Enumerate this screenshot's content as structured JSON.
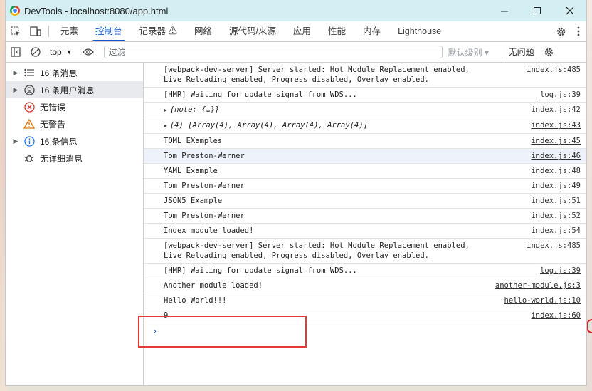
{
  "window": {
    "title": "DevTools - localhost:8080/app.html"
  },
  "colors": {
    "titlebar_bg": "#d4eef3",
    "accent": "#0b57d0",
    "error_red": "#d93025",
    "warning_yellow": "#e37400",
    "info_blue": "#1a73e8",
    "annotation_box": "#e53935"
  },
  "tabs": [
    {
      "label": "元素"
    },
    {
      "label": "控制台",
      "active": true
    },
    {
      "label": "记录器 ⚠"
    },
    {
      "label": "网络"
    },
    {
      "label": "源代码/来源"
    },
    {
      "label": "应用"
    },
    {
      "label": "性能"
    },
    {
      "label": "内存"
    },
    {
      "label": "Lighthouse"
    }
  ],
  "toolbar": {
    "context": "top",
    "filter_placeholder": "过滤",
    "levels": "默认级别 ▾",
    "issues": "无问题"
  },
  "sidebar": [
    {
      "label": "16 条消息",
      "icon": "list-icon",
      "expandable": true
    },
    {
      "label": "16 条用户消息",
      "icon": "user-icon",
      "expandable": true,
      "selected": true
    },
    {
      "label": "无错误",
      "icon": "error-icon",
      "expandable": false
    },
    {
      "label": "无警告",
      "icon": "warning-icon",
      "expandable": false
    },
    {
      "label": "16 条信息",
      "icon": "info-icon",
      "expandable": true
    },
    {
      "label": "无详细消息",
      "icon": "bug-icon",
      "expandable": false
    }
  ],
  "console": [
    {
      "text": "[webpack-dev-server] Server started: Hot Module Replacement enabled,\nLive Reloading enabled, Progress disabled, Overlay enabled.",
      "source": "index.js:485"
    },
    {
      "text": "[HMR] Waiting for update signal from WDS...",
      "source": "log.js:39"
    },
    {
      "text": "{note: {…}}",
      "source": "index.js:42",
      "object": true
    },
    {
      "text": "(4) [Array(4), Array(4), Array(4), Array(4)]",
      "source": "index.js:43",
      "object": true
    },
    {
      "text": "TOML EXamples",
      "source": "index.js:45"
    },
    {
      "text": "Tom Preston-Werner",
      "source": "index.js:46",
      "highlight": true
    },
    {
      "text": "YAML Example",
      "source": "index.js:48"
    },
    {
      "text": "Tom Preston-Werner",
      "source": "index.js:49"
    },
    {
      "text": "JSON5 Example",
      "source": "index.js:51"
    },
    {
      "text": "Tom Preston-Werner",
      "source": "index.js:52"
    },
    {
      "text": "Index module loaded!",
      "source": "index.js:54"
    },
    {
      "text": "[webpack-dev-server] Server started: Hot Module Replacement enabled,\nLive Reloading enabled, Progress disabled, Overlay enabled.",
      "source": "index.js:485"
    },
    {
      "text": "[HMR] Waiting for update signal from WDS...",
      "source": "log.js:39"
    },
    {
      "text": "Another module loaded!",
      "source": "another-module.js:3"
    },
    {
      "text": "Hello World!!!",
      "source": "hello-world.js:10"
    },
    {
      "text": "9",
      "source": "index.js:60"
    }
  ],
  "prompt_glyph": "›"
}
